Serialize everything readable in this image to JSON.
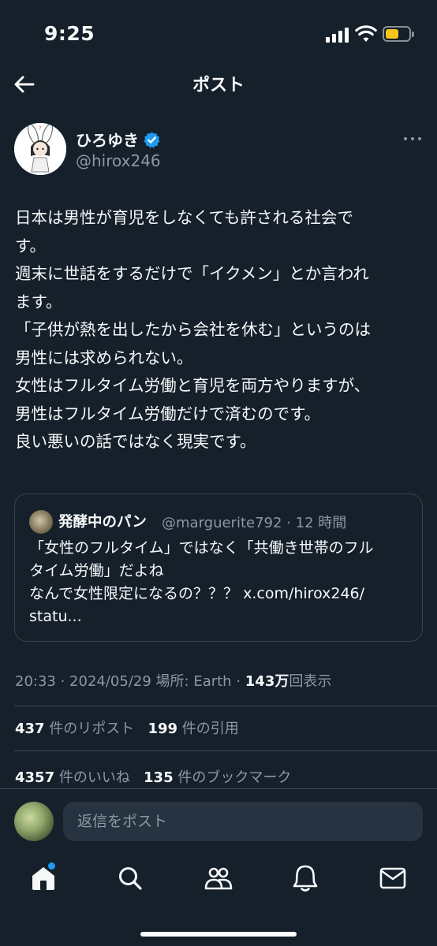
{
  "status_bar": {
    "time": "9:25"
  },
  "header": {
    "title": "ポスト"
  },
  "author": {
    "name": "ひろゆき",
    "handle": "@hirox246"
  },
  "post": {
    "lines": [
      "日本は男性が育児をしなくても許される社会で",
      "す。",
      "週末に世話をするだけで「イクメン」とか言われ",
      "ます。",
      "「子供が熱を出したから会社を休む」というのは",
      "男性には求められない。",
      "女性はフルタイム労働と育児を両方やりますが、",
      "男性はフルタイム労働だけで済むのです。",
      "良い悪いの話ではなく現実です。"
    ]
  },
  "quote": {
    "name": "発酵中のパン",
    "handle": "@marguerite792",
    "time": "12 時間",
    "lines": [
      "「女性のフルタイム」ではなく「共働き世帯のフル",
      "タイム労働」だよね",
      "なんで女性限定になるの？？？ x.com/hirox246/",
      "statu..."
    ]
  },
  "meta": {
    "time": "20:33",
    "date": "2024/05/29",
    "location": "場所: Earth",
    "views_count": "143万",
    "views_label": "回表示"
  },
  "stats": {
    "reposts_count": "437",
    "reposts_label": "件のリポスト",
    "quotes_count": "199",
    "quotes_label": "件の引用",
    "likes_count": "4357",
    "likes_label": "件のいいね",
    "bookmarks_count": "135",
    "bookmarks_label": "件のブックマーク"
  },
  "reply": {
    "placeholder": "返信をポスト"
  },
  "colors": {
    "background": "#15202b",
    "text": "#f7f9f9",
    "secondary": "#8b98a5",
    "accent": "#1d9bf0",
    "border": "#38444d"
  },
  "icons": [
    "back-arrow-icon",
    "verified-badge-icon",
    "more-icon",
    "home-icon",
    "search-icon",
    "communities-icon",
    "notifications-icon",
    "messages-icon"
  ]
}
